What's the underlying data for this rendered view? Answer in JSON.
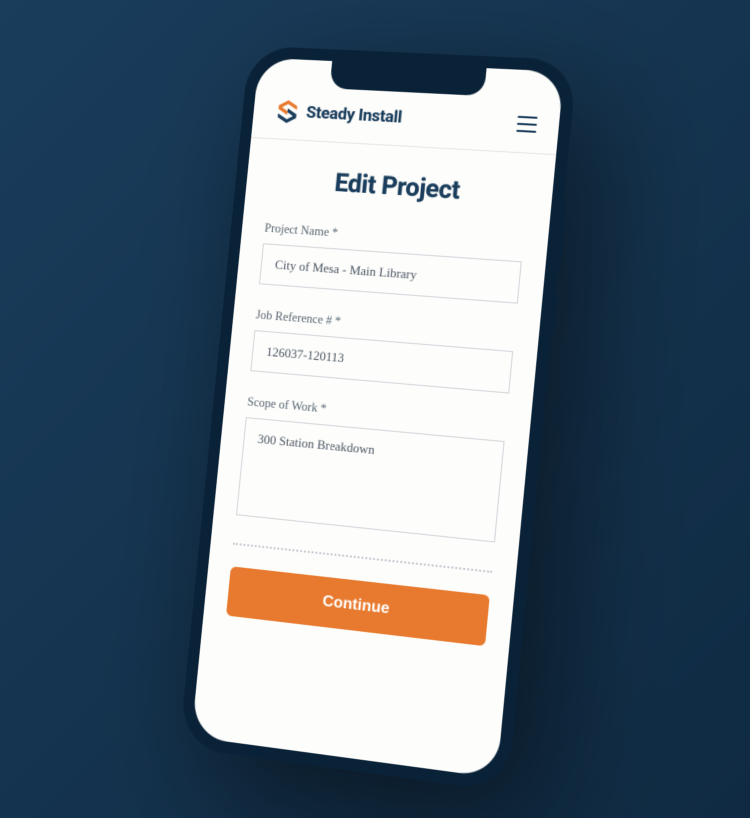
{
  "header": {
    "brand": "Steady Install"
  },
  "page": {
    "title": "Edit Project"
  },
  "form": {
    "project_name": {
      "label": "Project Name *",
      "value": "City of Mesa - Main Library"
    },
    "job_reference": {
      "label": "Job Reference # *",
      "value": "126037-120113"
    },
    "scope_of_work": {
      "label": "Scope of Work *",
      "value": "300 Station Breakdown"
    },
    "continue_label": "Continue"
  }
}
